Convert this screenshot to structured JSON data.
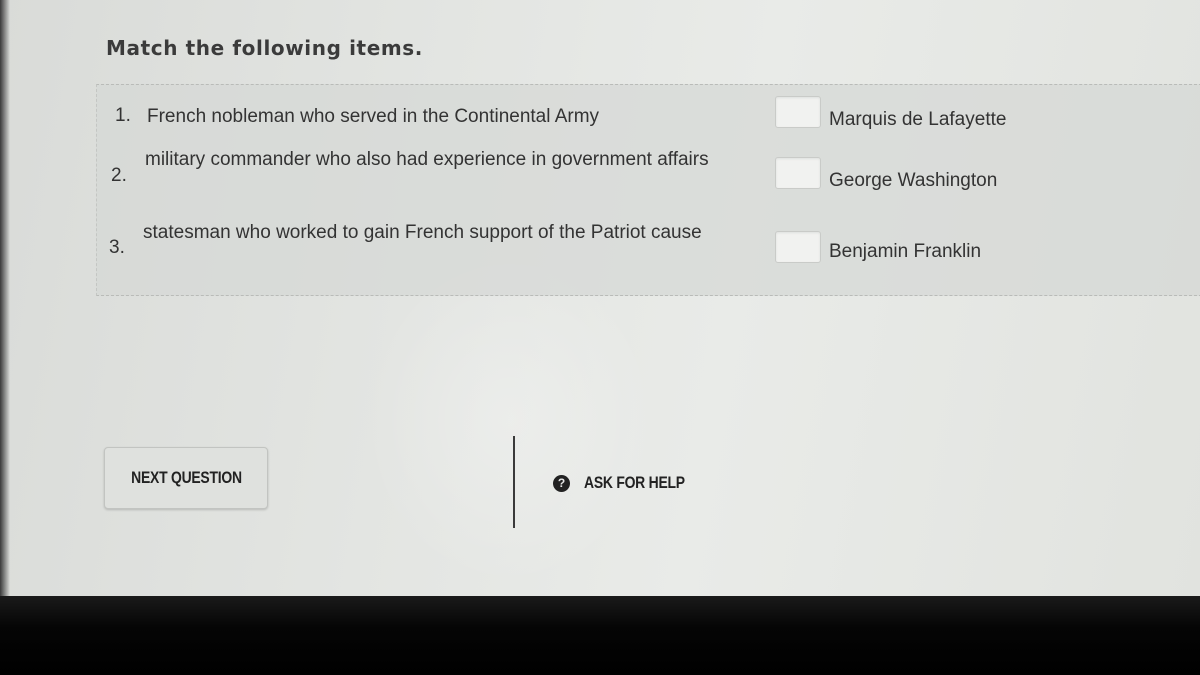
{
  "title": "Match the following items.",
  "questions": [
    {
      "number": "1.",
      "text": "French nobleman who served in the Continental Army"
    },
    {
      "number": "2.",
      "text": "military commander who also had experience in government affairs"
    },
    {
      "number": "3.",
      "text": "statesman who worked to gain French support of the Patriot cause"
    }
  ],
  "choices": [
    {
      "label": "Marquis de Lafayette"
    },
    {
      "label": "George Washington"
    },
    {
      "label": "Benjamin Franklin"
    }
  ],
  "footer": {
    "next_label": "NEXT QUESTION",
    "help_label": "ASK FOR HELP",
    "help_icon_glyph": "?"
  }
}
